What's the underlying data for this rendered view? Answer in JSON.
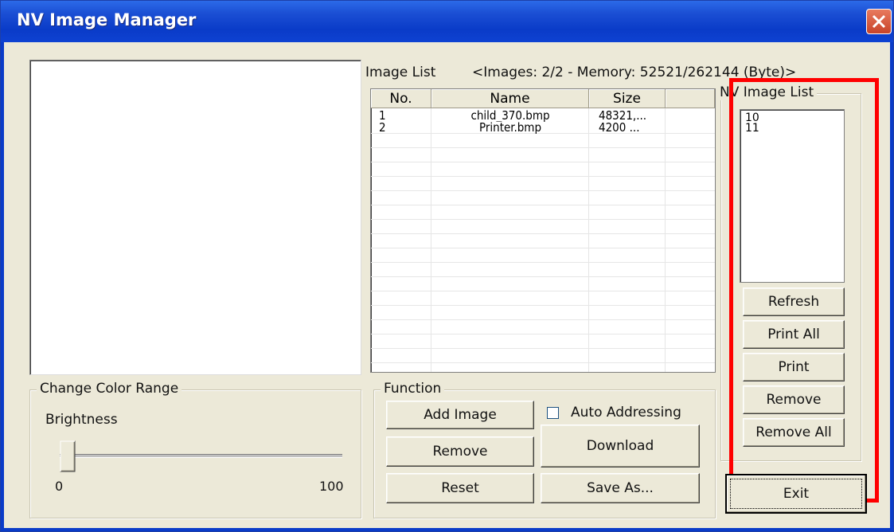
{
  "window": {
    "title": "NV Image Manager"
  },
  "image_list": {
    "label": "Image List",
    "summary": "<Images: 2/2 - Memory: 52521/262144 (Byte)>",
    "columns": [
      "No.",
      "Name",
      "Size"
    ],
    "rows": [
      {
        "no": "1",
        "name": "child_370.bmp",
        "size": "48321,..."
      },
      {
        "no": "2",
        "name": "Printer.bmp",
        "size": "4200 ..."
      }
    ]
  },
  "nv_image_list": {
    "label": "NV Image List",
    "items": [
      "10",
      "11"
    ],
    "buttons": {
      "refresh": "Refresh",
      "print_all": "Print All",
      "print": "Print",
      "remove": "Remove",
      "remove_all": "Remove All"
    }
  },
  "color_range": {
    "label": "Change Color Range",
    "brightness_label": "Brightness",
    "min": "0",
    "max": "100",
    "value": 0
  },
  "function": {
    "label": "Function",
    "add_image": "Add Image",
    "auto_addressing": "Auto Addressing",
    "auto_addressing_checked": false,
    "remove": "Remove",
    "download": "Download",
    "reset": "Reset",
    "save_as": "Save As..."
  },
  "exit_label": "Exit",
  "colors": {
    "title_bar": "#0A3BC8",
    "highlight": "#FF0000",
    "window_bg": "#ECE9D8"
  }
}
